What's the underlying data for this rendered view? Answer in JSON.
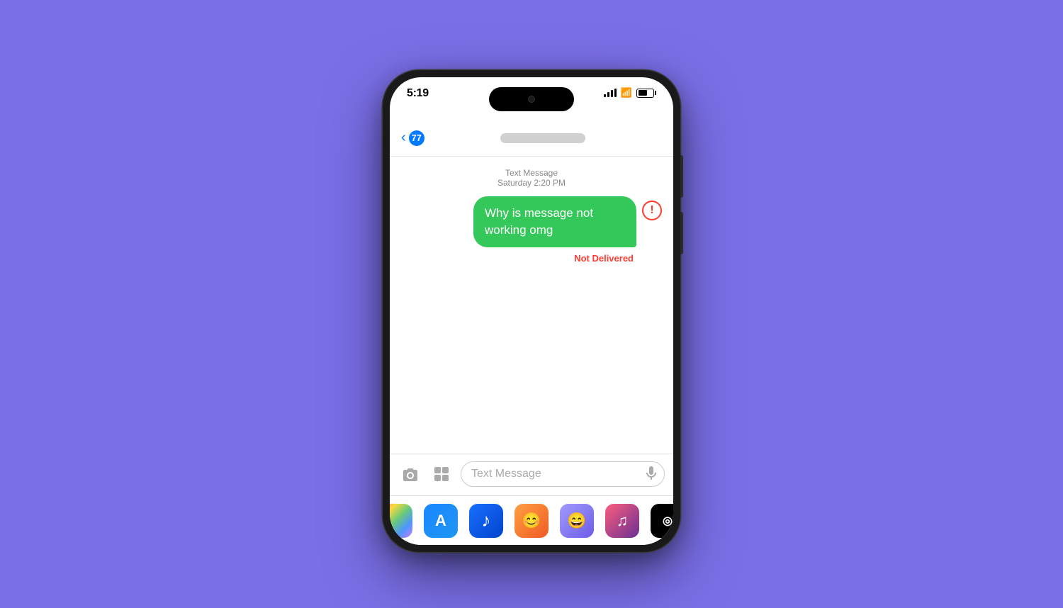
{
  "background_color": "#7B6FE8",
  "status_bar": {
    "time": "5:19",
    "signal_label": "signal bars",
    "wifi_label": "wifi",
    "battery_label": "battery",
    "battery_percent": "61"
  },
  "nav": {
    "back_count": "77",
    "contact_name_blurred": true
  },
  "messages": {
    "meta_type": "Text Message",
    "meta_date": "Saturday 2:20 PM",
    "bubble_text": "Why is message not working omg",
    "error_symbol": "!",
    "not_delivered_label": "Not Delivered"
  },
  "input": {
    "placeholder": "Text Message",
    "camera_icon": "📷",
    "apps_icon": "A",
    "mic_icon": "🎤"
  },
  "dock": {
    "items": [
      {
        "name": "Photos",
        "class": "dock-photos"
      },
      {
        "name": "App Store",
        "class": "dock-appstore",
        "symbol": "A"
      },
      {
        "name": "Shazam",
        "class": "dock-shazam",
        "symbol": "♪"
      },
      {
        "name": "Bitmoji 1",
        "class": "dock-bitmoji1",
        "symbol": "😊"
      },
      {
        "name": "Bitmoji 2",
        "class": "dock-bitmoji2",
        "symbol": "😄"
      },
      {
        "name": "Music",
        "class": "dock-music",
        "symbol": "♫"
      },
      {
        "name": "Fitness",
        "class": "dock-activity",
        "symbol": "◎"
      }
    ]
  }
}
